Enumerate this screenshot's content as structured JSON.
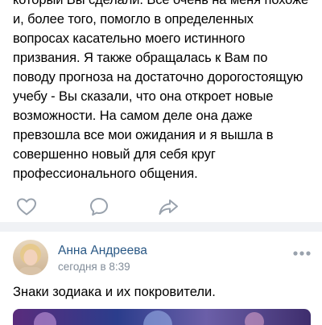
{
  "post1": {
    "lines": [
      "который Вы сделали. Все очень на меня похоже",
      "и, более того, помогло в определенных",
      "вопросах касательно моего истинного",
      "призвания. Я также обращалась к Вам по",
      "поводу прогноза на достаточно дорогостоящую",
      "учебу - Вы сказали, что она откроет новые",
      "возможности. На самом деле она даже",
      "превзошла все мои ожидания и я вышла в",
      "совершенно новый для себя круг",
      "профессионального общения."
    ],
    "actions": {
      "like_icon": "heart-icon",
      "comment_icon": "comment-icon",
      "share_icon": "share-icon"
    }
  },
  "post2": {
    "author": "Анна Андреева",
    "time": "сегодня в 8:39",
    "text": "Знаки зодиака и их покровители.",
    "more_icon": "more-icon"
  },
  "colors": {
    "author_link": "#2a5885",
    "secondary_text": "#818c99",
    "icon_gray": "#99a2ad",
    "separator": "#f0f2f5"
  }
}
